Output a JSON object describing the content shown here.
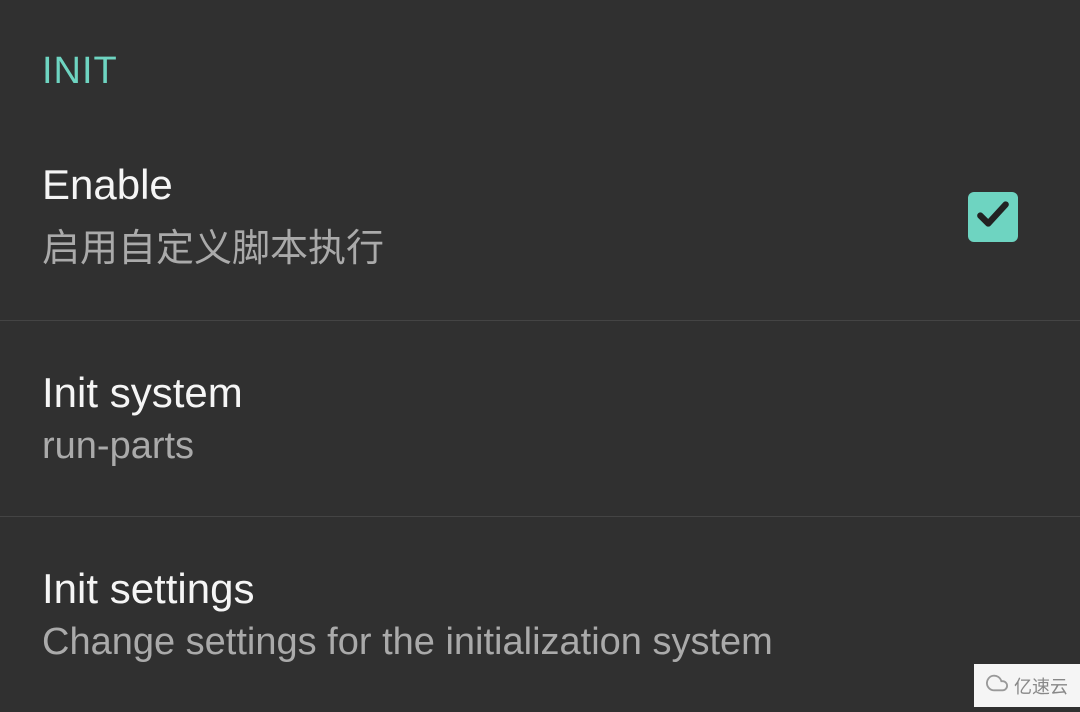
{
  "section": {
    "header": "INIT"
  },
  "settings": {
    "enable": {
      "title": "Enable",
      "subtitle": "启用自定义脚本执行",
      "checked": true
    },
    "initSystem": {
      "title": "Init system",
      "subtitle": "run-parts"
    },
    "initSettings": {
      "title": "Init settings",
      "subtitle": "Change settings for the initialization system"
    }
  },
  "watermark": {
    "text": "亿速云"
  }
}
